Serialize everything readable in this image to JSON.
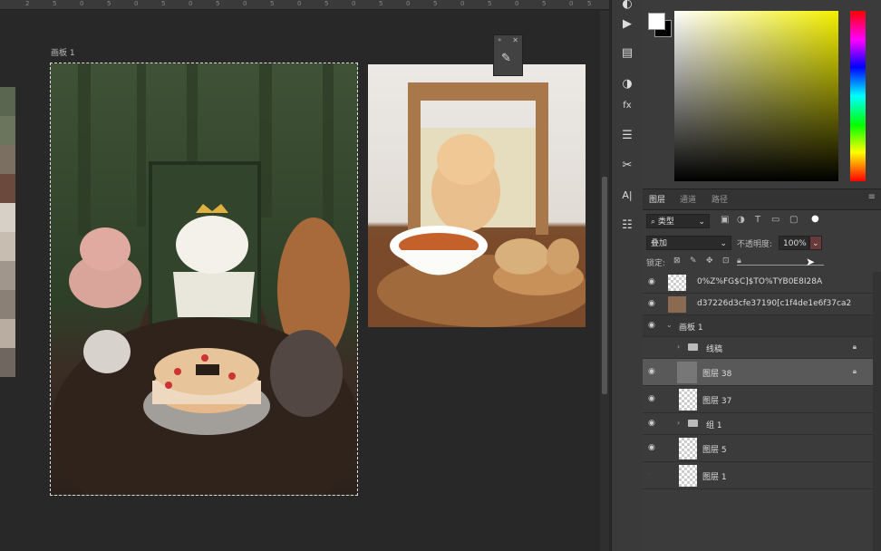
{
  "ruler": {
    "ticks": [
      "2",
      "5",
      "0",
      "5",
      "0",
      "5",
      "0",
      "5",
      "0",
      "5",
      "0",
      "5",
      "0",
      "5",
      "0",
      "5",
      "0",
      "5",
      "0",
      "5",
      "0",
      "5"
    ]
  },
  "artboard": {
    "label": "画板 1"
  },
  "swatch_colors": [
    "#5a6650",
    "#6b745d",
    "#7a6f60",
    "#6b4a3d",
    "#d7d0c6",
    "#c7bdb0",
    "#a0968c",
    "#8a8076",
    "#b9ada2",
    "#6f675f"
  ],
  "tabs": {
    "layers": "图层",
    "channels": "通道",
    "paths": "路径"
  },
  "filter": {
    "kind": "类型"
  },
  "blend": {
    "mode": "叠加",
    "opacity_label": "不透明度:",
    "opacity_value": "100%"
  },
  "lock": {
    "label": "锁定:"
  },
  "layers": [
    {
      "name": "0%Z%FG$C]$TO%TYB0E8I28A",
      "visible": true
    },
    {
      "name": "d37226d3cfe37190[c1f4de1e6f37ca2",
      "visible": true
    },
    {
      "name": "画板 1",
      "visible": true
    },
    {
      "name": "线稿",
      "visible": false,
      "locked": true
    },
    {
      "name": "图层 38",
      "visible": true,
      "locked": true
    },
    {
      "name": "图层 37",
      "visible": true
    },
    {
      "name": "组 1",
      "visible": true
    },
    {
      "name": "图层 5",
      "visible": true
    },
    {
      "name": "图层 1",
      "visible": false
    }
  ]
}
